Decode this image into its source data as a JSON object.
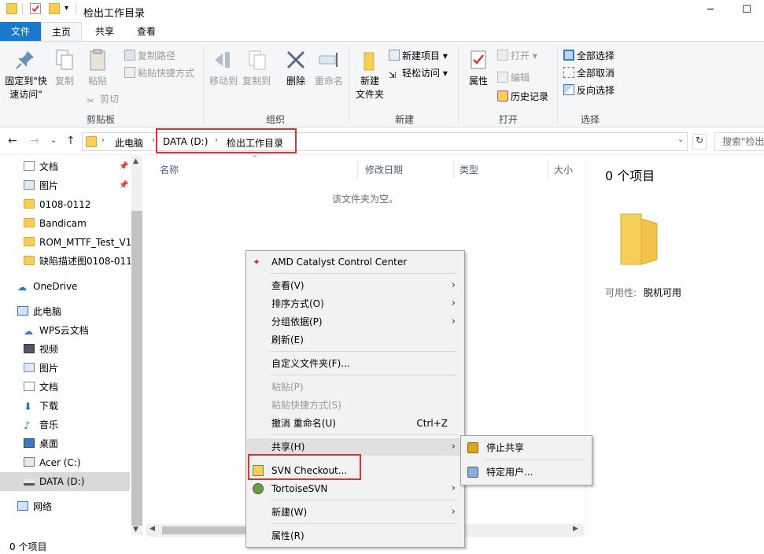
{
  "window": {
    "title": "检出工作目录",
    "minimize": "─",
    "maximize": "☐"
  },
  "tabs": {
    "file": "文件",
    "home": "主页",
    "share": "共享",
    "view": "查看"
  },
  "ribbon": {
    "clipboard": {
      "label": "剪贴板",
      "pin": "固定到\"快速访问\"",
      "copy": "复制",
      "paste": "粘贴",
      "copy_path": "复制路径",
      "paste_shortcut": "粘贴快捷方式",
      "cut": "剪切"
    },
    "organize": {
      "label": "组织",
      "move_to": "移动到",
      "copy_to": "复制到",
      "delete": "删除",
      "rename": "重命名"
    },
    "new": {
      "label": "新建",
      "new_folder": "新建\n文件夹",
      "new_item": "新建项目 ▾",
      "easy_access": "轻松访问 ▾"
    },
    "open": {
      "label": "打开",
      "properties": "属性",
      "open": "打开 ▾",
      "edit": "编辑",
      "history": "历史记录"
    },
    "select": {
      "label": "选择",
      "select_all": "全部选择",
      "select_none": "全部取消",
      "invert": "反向选择"
    }
  },
  "address": {
    "crumbs": [
      "此电脑",
      "DATA (D:)",
      "检出工作目录"
    ],
    "search_placeholder": "搜索\"检出"
  },
  "nav": {
    "items": [
      "文档",
      "图片",
      "0108-0112",
      "Bandicam",
      "ROM_MTTF_Test_V1",
      "缺陷描述图0108-011",
      "OneDrive",
      "此电脑",
      "WPS云文档",
      "视频",
      "图片",
      "文档",
      "下载",
      "音乐",
      "桌面",
      "Acer (C:)",
      "DATA (D:)",
      "网络"
    ]
  },
  "content": {
    "columns": [
      "名称",
      "修改日期",
      "类型",
      "大小"
    ],
    "empty_text": "该文件夹为空。"
  },
  "details": {
    "count": "0 个项目",
    "availability_label": "可用性:",
    "availability_value": "脱机可用"
  },
  "status": {
    "count": "0 个项目"
  },
  "context_menu": {
    "amd": "AMD Catalyst Control Center",
    "view": "查看(V)",
    "sort": "排序方式(O)",
    "group": "分组依据(P)",
    "refresh": "刷新(E)",
    "customize": "自定义文件夹(F)...",
    "paste": "粘贴(P)",
    "paste_shortcut": "粘贴快捷方式(S)",
    "undo": "撤消 重命名(U)",
    "undo_shortcut": "Ctrl+Z",
    "share": "共享(H)",
    "svn_checkout": "SVN Checkout...",
    "tortoise": "TortoiseSVN",
    "new": "新建(W)",
    "properties": "属性(R)"
  },
  "share_submenu": {
    "stop_sharing": "停止共享",
    "specific_people": "特定用户..."
  },
  "colors": {
    "accent": "#1979ca",
    "highlight_red": "#e03131",
    "folder": "#f6cf5a"
  }
}
